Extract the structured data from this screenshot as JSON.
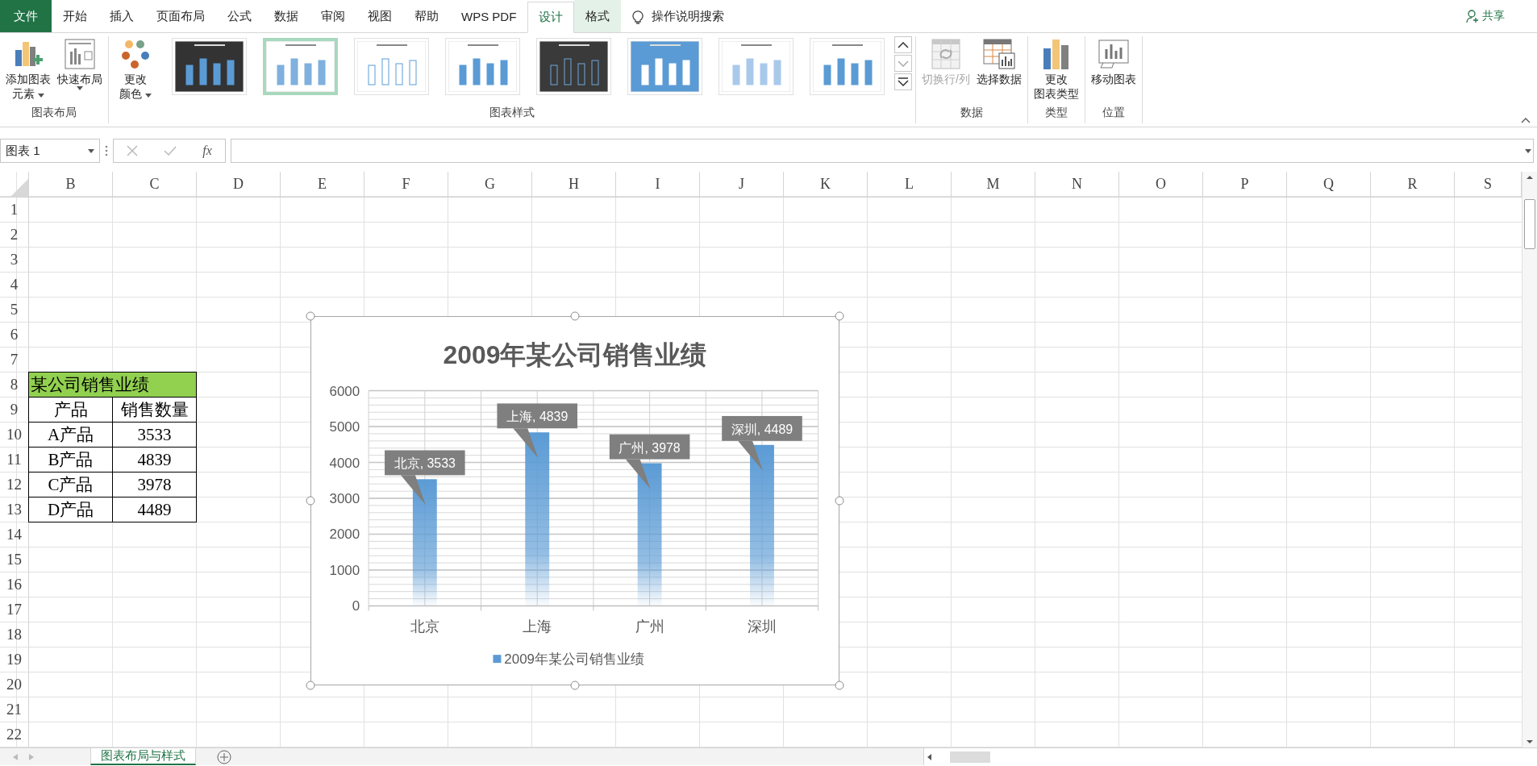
{
  "ribbon_tabs": [
    {
      "label": "文件",
      "kind": "file",
      "selected": false
    },
    {
      "label": "开始",
      "kind": "normal",
      "selected": false
    },
    {
      "label": "插入",
      "kind": "normal",
      "selected": false
    },
    {
      "label": "页面布局",
      "kind": "normal",
      "selected": false
    },
    {
      "label": "公式",
      "kind": "normal",
      "selected": false
    },
    {
      "label": "数据",
      "kind": "normal",
      "selected": false
    },
    {
      "label": "审阅",
      "kind": "normal",
      "selected": false
    },
    {
      "label": "视图",
      "kind": "normal",
      "selected": false
    },
    {
      "label": "帮助",
      "kind": "normal",
      "selected": false
    },
    {
      "label": "WPS PDF",
      "kind": "normal",
      "selected": false
    },
    {
      "label": "设计",
      "kind": "contextual",
      "selected": true
    },
    {
      "label": "格式",
      "kind": "contextual",
      "selected": false
    }
  ],
  "tell_me": {
    "label": "操作说明搜索"
  },
  "share": {
    "label": "共享"
  },
  "ribbon_groups": [
    {
      "kind": "buttons",
      "label": "图表布局",
      "buttons": [
        {
          "lines": [
            "添加图表",
            "元素"
          ],
          "dropdown": true,
          "disabled": false
        },
        {
          "lines": [
            "快速布局"
          ],
          "dropdown": true,
          "disabled": false
        }
      ]
    },
    {
      "kind": "gallery",
      "label": "图表样式",
      "buttons": [
        {
          "lines": [
            "更改",
            "颜色"
          ],
          "dropdown": true,
          "disabled": false
        }
      ],
      "styles": [
        {
          "kind": "dark",
          "selected": false
        },
        {
          "kind": "gradient",
          "selected": true
        },
        {
          "kind": "outline",
          "selected": false
        },
        {
          "kind": "plain",
          "selected": false
        },
        {
          "kind": "dark-outline",
          "selected": false
        },
        {
          "kind": "blue-striped",
          "selected": false
        },
        {
          "kind": "light",
          "selected": false
        },
        {
          "kind": "plain",
          "selected": false
        }
      ]
    },
    {
      "kind": "buttons",
      "label": "数据",
      "buttons": [
        {
          "lines": [
            "切换行/列"
          ],
          "dropdown": false,
          "disabled": true
        },
        {
          "lines": [
            "选择数据"
          ],
          "dropdown": false,
          "disabled": false
        }
      ]
    },
    {
      "kind": "buttons",
      "label": "类型",
      "buttons": [
        {
          "lines": [
            "更改",
            "图表类型"
          ],
          "dropdown": false,
          "disabled": false
        }
      ]
    },
    {
      "kind": "buttons",
      "label": "位置",
      "buttons": [
        {
          "lines": [
            "移动图表"
          ],
          "dropdown": false,
          "disabled": false
        }
      ]
    }
  ],
  "formula_bar": {
    "name_box": "图表 1",
    "function_label": "fx"
  },
  "sheet": {
    "columns": [
      "B",
      "C",
      "D",
      "E",
      "F",
      "G",
      "H",
      "I",
      "J",
      "K",
      "L",
      "M",
      "N",
      "O",
      "P",
      "Q",
      "R",
      "S"
    ],
    "rows": [
      "1",
      "2",
      "3",
      "4",
      "5",
      "6",
      "7",
      "8",
      "9",
      "10",
      "11",
      "12",
      "13",
      "14",
      "15",
      "16",
      "17",
      "18",
      "19",
      "20",
      "21",
      "22"
    ],
    "table": {
      "title": "某公司销售业绩",
      "header": [
        "产品",
        "销售数量"
      ],
      "rows": [
        [
          "A产品",
          "3533"
        ],
        [
          "B产品",
          "4839"
        ],
        [
          "C产品",
          "3978"
        ],
        [
          "D产品",
          "4489"
        ]
      ]
    }
  },
  "chart": {
    "selected": true,
    "chart_data": {
      "type": "bar",
      "title": "2009年某公司销售业绩",
      "categories": [
        "北京",
        "上海",
        "广州",
        "深圳"
      ],
      "series": [
        {
          "name": "2009年某公司销售业绩",
          "color": "#5b9bd5",
          "values": [
            3533,
            4839,
            3978,
            4489
          ]
        }
      ],
      "grid": true,
      "ylim": [
        0,
        6000
      ],
      "yticks": [
        0,
        1000,
        2000,
        3000,
        4000,
        5000,
        6000
      ],
      "value_labels": [
        "北京, 3533",
        "上海, 4839",
        "广州, 3978",
        "深圳, 4489"
      ]
    }
  },
  "sheet_tabs": [
    {
      "label": "图表布局与样式",
      "selected": true
    }
  ]
}
